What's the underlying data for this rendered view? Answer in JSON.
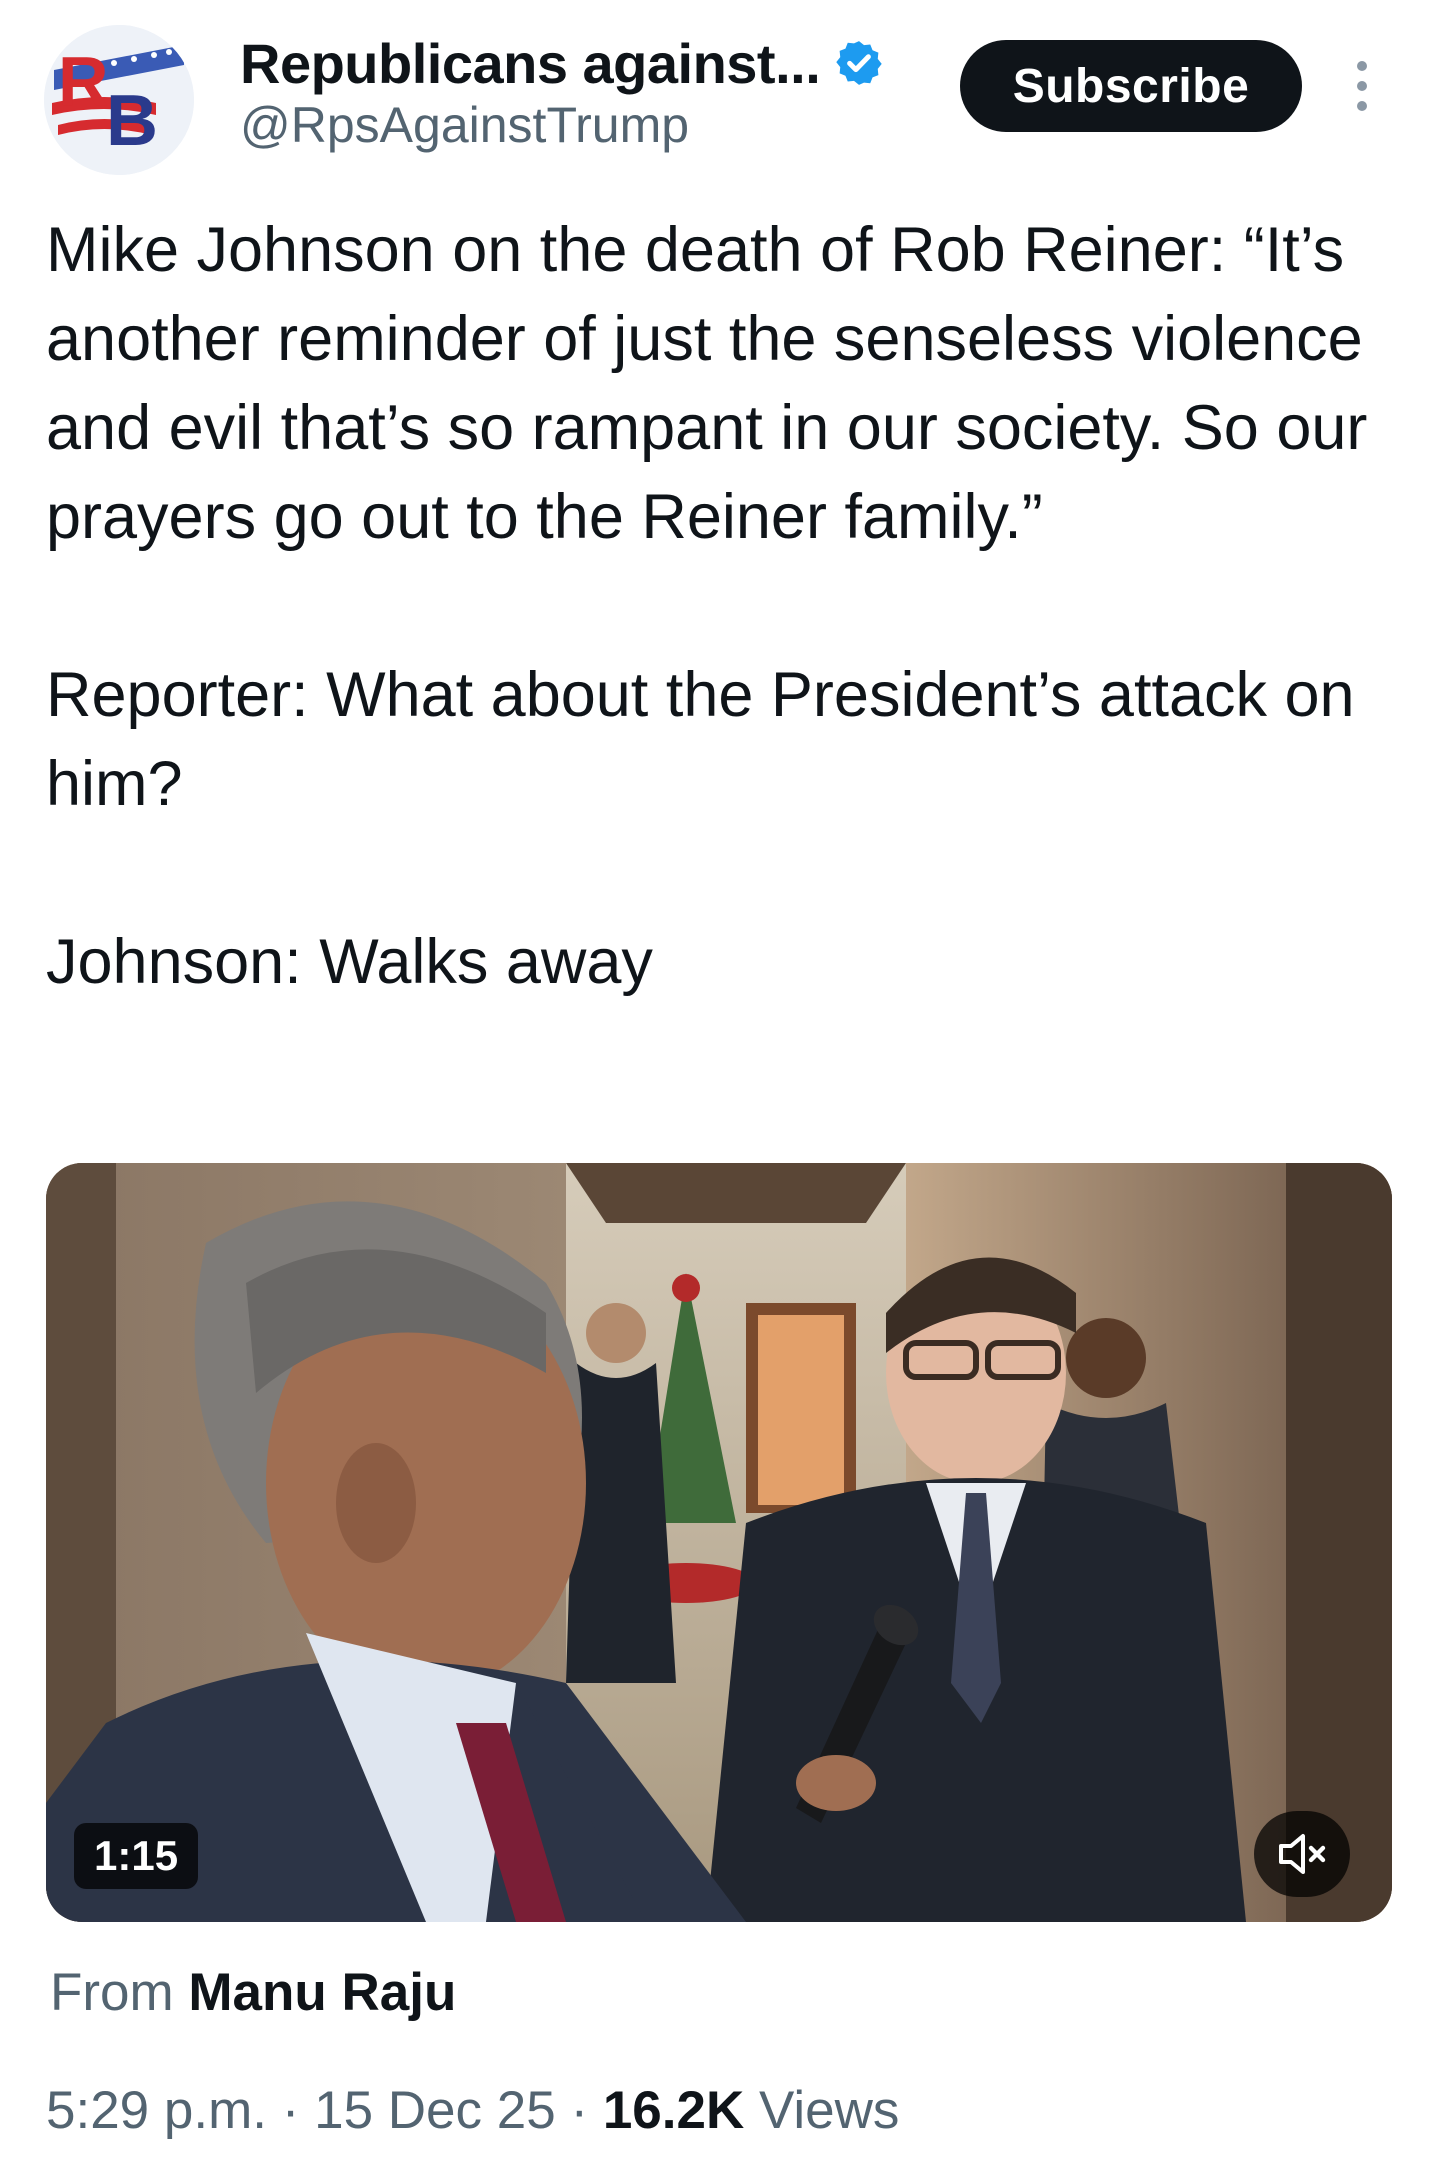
{
  "author": {
    "display_name": "Republicans against...",
    "handle": "@RpsAgainstTrump",
    "verified": true,
    "avatar_letters": "RB",
    "avatar_colors": {
      "red": "#d62b2f",
      "blue": "#2a3a8c",
      "star_band": "#3a5bb5"
    }
  },
  "actions": {
    "subscribe_label": "Subscribe",
    "more_icon": "vertical-ellipsis-icon"
  },
  "tweet": {
    "paragraphs": [
      "Mike Johnson on the death of Rob Reiner: “It’s another reminder of just the senseless violence and evil that’s so rampant in our society. So our prayers go out to the Reiner family.”",
      "Reporter: What about the President’s attack on him?",
      "Johnson: Walks away"
    ]
  },
  "media": {
    "type": "video",
    "duration": "1:15",
    "mute_icon": "speaker-muted-icon"
  },
  "attribution": {
    "prefix": "From",
    "source": "Manu Raju"
  },
  "meta": {
    "time": "5:29 p.m.",
    "separator": "·",
    "date": "15 Dec 25",
    "views_count": "16.2K",
    "views_label": "Views"
  },
  "colors": {
    "text_primary": "#0f1419",
    "text_secondary": "#536471",
    "verified_blue": "#1d9bf0",
    "button_bg": "#0f1419"
  }
}
